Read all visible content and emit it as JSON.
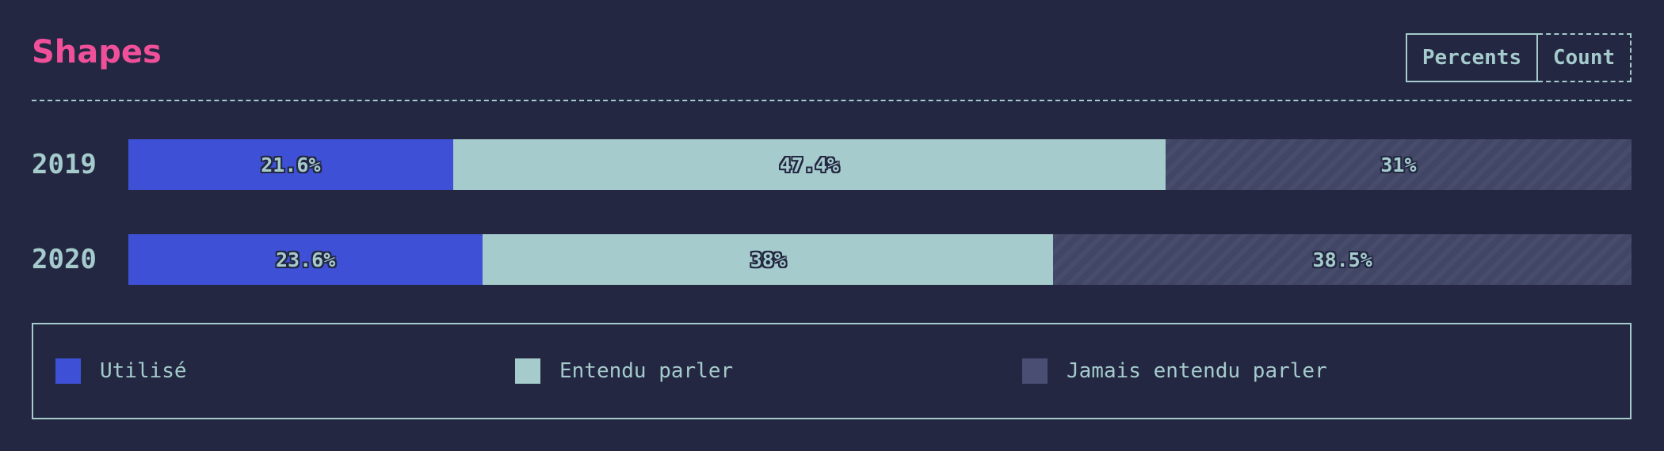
{
  "header": {
    "title": "Shapes",
    "toggle": {
      "percents_label": "Percents",
      "count_label": "Count"
    }
  },
  "colors": {
    "background": "#232742",
    "accent": "#f0509a",
    "text": "#a5cbcc",
    "used": "#3e51d6",
    "heard": "#a5cbcc",
    "never": "#414666"
  },
  "chart_data": {
    "type": "bar",
    "orientation": "horizontal",
    "stacked": true,
    "normalized": true,
    "categories": [
      "2019",
      "2020"
    ],
    "series": [
      {
        "name": "Utilisé",
        "values": [
          21.6,
          23.6
        ],
        "labels": [
          "21.6%",
          "23.6%"
        ]
      },
      {
        "name": "Entendu parler",
        "values": [
          47.4,
          38
        ],
        "labels": [
          "47.4%",
          "38%"
        ]
      },
      {
        "name": "Jamais entendu parler",
        "values": [
          31,
          38.5
        ],
        "labels": [
          "31%",
          "38.5%"
        ]
      }
    ],
    "legend_position": "bottom"
  }
}
